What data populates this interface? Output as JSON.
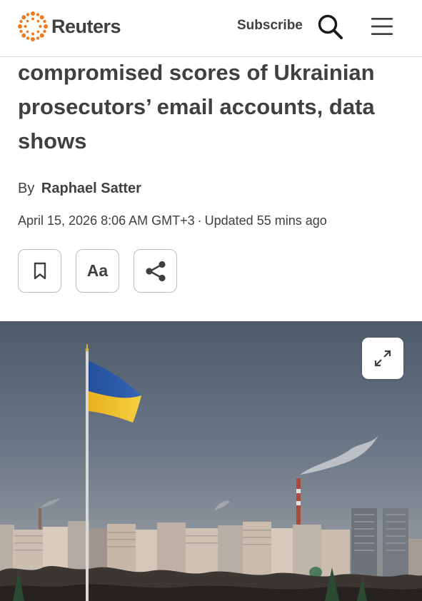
{
  "header": {
    "logo_text": "Reuters",
    "subscribe_label": "Subscribe",
    "search_icon": "search-icon",
    "menu_icon": "hamburger-menu-icon",
    "brand_color": "#f07a1f"
  },
  "article": {
    "headline": "compromised scores of Ukrainian prosecutors’ email accounts, data shows",
    "byline_prefix": "By",
    "author": "Raphael Satter",
    "date": "April 15, 2026 8:06 AM GMT+3",
    "separator": "·",
    "updated": "Updated 55 mins ago"
  },
  "actions": {
    "bookmark_icon": "bookmark-icon",
    "text_size_label": "Aa",
    "share_icon": "share-icon"
  },
  "image": {
    "expand_icon": "expand-icon",
    "flag_colors": [
      "#2a5aa8",
      "#f2c42c"
    ]
  }
}
